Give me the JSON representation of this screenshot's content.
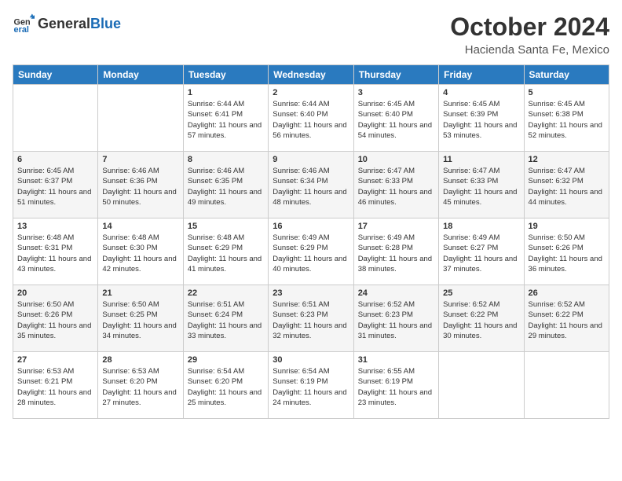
{
  "logo": {
    "general": "General",
    "blue": "Blue"
  },
  "header": {
    "month": "October 2024",
    "location": "Hacienda Santa Fe, Mexico"
  },
  "weekdays": [
    "Sunday",
    "Monday",
    "Tuesday",
    "Wednesday",
    "Thursday",
    "Friday",
    "Saturday"
  ],
  "weeks": [
    [
      {
        "day": "",
        "info": ""
      },
      {
        "day": "",
        "info": ""
      },
      {
        "day": "1",
        "info": "Sunrise: 6:44 AM\nSunset: 6:41 PM\nDaylight: 11 hours and 57 minutes."
      },
      {
        "day": "2",
        "info": "Sunrise: 6:44 AM\nSunset: 6:40 PM\nDaylight: 11 hours and 56 minutes."
      },
      {
        "day": "3",
        "info": "Sunrise: 6:45 AM\nSunset: 6:40 PM\nDaylight: 11 hours and 54 minutes."
      },
      {
        "day": "4",
        "info": "Sunrise: 6:45 AM\nSunset: 6:39 PM\nDaylight: 11 hours and 53 minutes."
      },
      {
        "day": "5",
        "info": "Sunrise: 6:45 AM\nSunset: 6:38 PM\nDaylight: 11 hours and 52 minutes."
      }
    ],
    [
      {
        "day": "6",
        "info": "Sunrise: 6:45 AM\nSunset: 6:37 PM\nDaylight: 11 hours and 51 minutes."
      },
      {
        "day": "7",
        "info": "Sunrise: 6:46 AM\nSunset: 6:36 PM\nDaylight: 11 hours and 50 minutes."
      },
      {
        "day": "8",
        "info": "Sunrise: 6:46 AM\nSunset: 6:35 PM\nDaylight: 11 hours and 49 minutes."
      },
      {
        "day": "9",
        "info": "Sunrise: 6:46 AM\nSunset: 6:34 PM\nDaylight: 11 hours and 48 minutes."
      },
      {
        "day": "10",
        "info": "Sunrise: 6:47 AM\nSunset: 6:33 PM\nDaylight: 11 hours and 46 minutes."
      },
      {
        "day": "11",
        "info": "Sunrise: 6:47 AM\nSunset: 6:33 PM\nDaylight: 11 hours and 45 minutes."
      },
      {
        "day": "12",
        "info": "Sunrise: 6:47 AM\nSunset: 6:32 PM\nDaylight: 11 hours and 44 minutes."
      }
    ],
    [
      {
        "day": "13",
        "info": "Sunrise: 6:48 AM\nSunset: 6:31 PM\nDaylight: 11 hours and 43 minutes."
      },
      {
        "day": "14",
        "info": "Sunrise: 6:48 AM\nSunset: 6:30 PM\nDaylight: 11 hours and 42 minutes."
      },
      {
        "day": "15",
        "info": "Sunrise: 6:48 AM\nSunset: 6:29 PM\nDaylight: 11 hours and 41 minutes."
      },
      {
        "day": "16",
        "info": "Sunrise: 6:49 AM\nSunset: 6:29 PM\nDaylight: 11 hours and 40 minutes."
      },
      {
        "day": "17",
        "info": "Sunrise: 6:49 AM\nSunset: 6:28 PM\nDaylight: 11 hours and 38 minutes."
      },
      {
        "day": "18",
        "info": "Sunrise: 6:49 AM\nSunset: 6:27 PM\nDaylight: 11 hours and 37 minutes."
      },
      {
        "day": "19",
        "info": "Sunrise: 6:50 AM\nSunset: 6:26 PM\nDaylight: 11 hours and 36 minutes."
      }
    ],
    [
      {
        "day": "20",
        "info": "Sunrise: 6:50 AM\nSunset: 6:26 PM\nDaylight: 11 hours and 35 minutes."
      },
      {
        "day": "21",
        "info": "Sunrise: 6:50 AM\nSunset: 6:25 PM\nDaylight: 11 hours and 34 minutes."
      },
      {
        "day": "22",
        "info": "Sunrise: 6:51 AM\nSunset: 6:24 PM\nDaylight: 11 hours and 33 minutes."
      },
      {
        "day": "23",
        "info": "Sunrise: 6:51 AM\nSunset: 6:23 PM\nDaylight: 11 hours and 32 minutes."
      },
      {
        "day": "24",
        "info": "Sunrise: 6:52 AM\nSunset: 6:23 PM\nDaylight: 11 hours and 31 minutes."
      },
      {
        "day": "25",
        "info": "Sunrise: 6:52 AM\nSunset: 6:22 PM\nDaylight: 11 hours and 30 minutes."
      },
      {
        "day": "26",
        "info": "Sunrise: 6:52 AM\nSunset: 6:22 PM\nDaylight: 11 hours and 29 minutes."
      }
    ],
    [
      {
        "day": "27",
        "info": "Sunrise: 6:53 AM\nSunset: 6:21 PM\nDaylight: 11 hours and 28 minutes."
      },
      {
        "day": "28",
        "info": "Sunrise: 6:53 AM\nSunset: 6:20 PM\nDaylight: 11 hours and 27 minutes."
      },
      {
        "day": "29",
        "info": "Sunrise: 6:54 AM\nSunset: 6:20 PM\nDaylight: 11 hours and 25 minutes."
      },
      {
        "day": "30",
        "info": "Sunrise: 6:54 AM\nSunset: 6:19 PM\nDaylight: 11 hours and 24 minutes."
      },
      {
        "day": "31",
        "info": "Sunrise: 6:55 AM\nSunset: 6:19 PM\nDaylight: 11 hours and 23 minutes."
      },
      {
        "day": "",
        "info": ""
      },
      {
        "day": "",
        "info": ""
      }
    ]
  ]
}
